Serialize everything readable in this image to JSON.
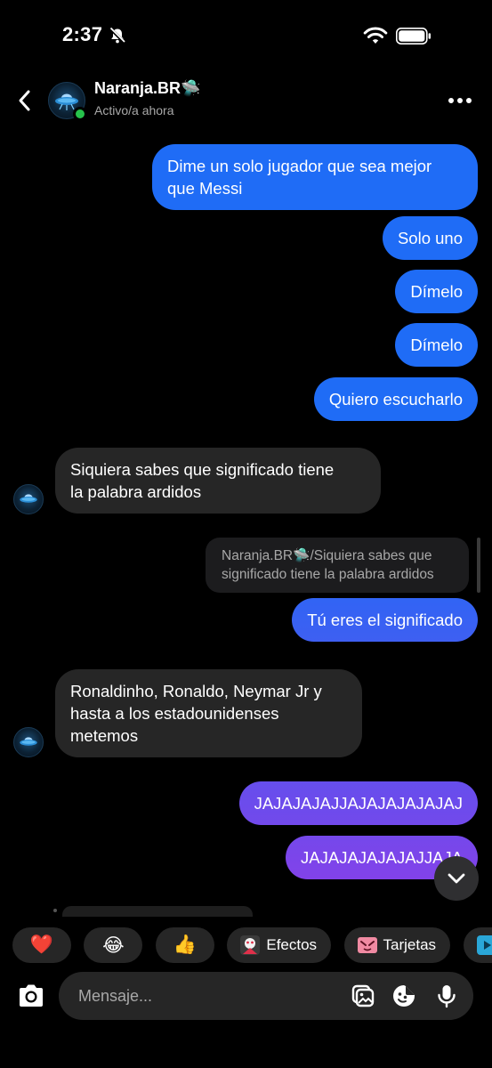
{
  "status_bar": {
    "time": "2:37"
  },
  "header": {
    "name": "Naranja.BR",
    "name_emoji": "🛸",
    "status": "Activo/a ahora"
  },
  "messages": [
    {
      "side": "sent",
      "lines": [
        "Dime un solo jugador que sea mejor",
        "que Messi"
      ]
    },
    {
      "side": "sent",
      "lines": [
        "Solo uno"
      ]
    },
    {
      "side": "sent",
      "lines": [
        "Dímelo"
      ]
    },
    {
      "side": "sent",
      "lines": [
        "Dímelo"
      ]
    },
    {
      "side": "sent",
      "lines": [
        "Quiero escucharlo"
      ]
    },
    {
      "side": "received",
      "lines": [
        "Siquiera sabes que significado tiene",
        "la palabra ardidos"
      ]
    },
    {
      "side": "sent",
      "lines": [
        "Tú eres el significado"
      ]
    },
    {
      "side": "received",
      "lines": [
        "Ronaldinho, Ronaldo, Neymar Jr y",
        "hasta a los estadounidenses",
        "metemos"
      ]
    },
    {
      "side": "sent",
      "lines": [
        "JAJAJAJAJJAJAJAJAJAJAJ"
      ]
    },
    {
      "side": "sent",
      "lines": [
        "JAJAJAJAJAJAJJAJA"
      ]
    }
  ],
  "reply_quote": {
    "author": "Naranja.BR",
    "author_emoji": "🛸",
    "text_line1": "/Siquiera sabes que",
    "text_line2": "significado tiene la palabra ardidos"
  },
  "quick_reactions": [
    "❤️",
    "😂",
    "👍"
  ],
  "chips": [
    {
      "label": "Efectos",
      "icon": "effects-icon"
    },
    {
      "label": "Tarjetas",
      "icon": "cards-icon"
    }
  ],
  "composer": {
    "placeholder": "Mensaje..."
  },
  "colors": {
    "background": "#000000",
    "sent_top": "#1f6cf6",
    "sent_bottom": "#8a3fe8",
    "received": "#262626",
    "online": "#27c24c"
  }
}
